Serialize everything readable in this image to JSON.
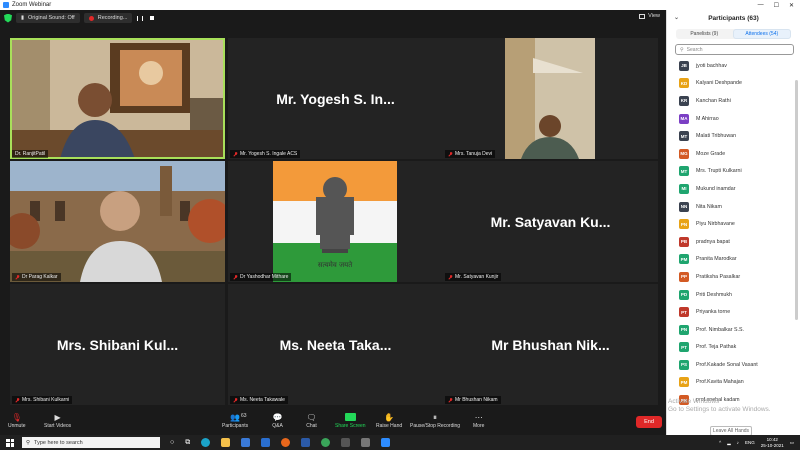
{
  "window": {
    "title": "Zoom Webinar"
  },
  "topbar": {
    "audio_label": "Original Sound: Off",
    "recording_label": "Recording...",
    "view_label": "View"
  },
  "tiles": [
    {
      "caption": "Dr. RanjitPatil",
      "bigname": "",
      "muted": false
    },
    {
      "caption": "Mr. Yogesh S. Ingale ACS",
      "bigname": "Mr. Yogesh S. In...",
      "muted": true
    },
    {
      "caption": "Mrs. Tanuja Devi",
      "bigname": "",
      "muted": true
    },
    {
      "caption": "Dr Parag Kalkar",
      "bigname": "",
      "muted": true
    },
    {
      "caption": "Dr Yashodhar Mithare",
      "bigname": "",
      "muted": true
    },
    {
      "caption": "Mr. Satyavan Kunjir",
      "bigname": "Mr. Satyavan Ku...",
      "muted": true
    },
    {
      "caption": "Mrs. Shibani Kulkarni",
      "bigname": "Mrs. Shibani Kul...",
      "muted": true
    },
    {
      "caption": "Ms. Neeta Takawale",
      "bigname": "Ms. Neeta Taka...",
      "muted": true
    },
    {
      "caption": "Mr Bhushan Nikam",
      "bigname": "Mr Bhushan Nik...",
      "muted": true
    }
  ],
  "emblem_motto": "सत्यमेव जयते",
  "sidebar": {
    "title": "Participants (63)",
    "tabs": [
      "Panelists (9)",
      "Attendees (54)"
    ],
    "search_placeholder": "Search",
    "participants": [
      {
        "initials": "JB",
        "name": "jyoti bachhav",
        "color": "#3a4250"
      },
      {
        "initials": "KD",
        "name": "Kalyani Deshpande",
        "color": "#e8a317"
      },
      {
        "initials": "KR",
        "name": "Kanchan  Rathi",
        "color": "#3a4250"
      },
      {
        "initials": "MA",
        "name": "M Ahirrao",
        "color": "#7b3fc4"
      },
      {
        "initials": "MT",
        "name": "Malati Tribhuwan",
        "color": "#3a4250"
      },
      {
        "initials": "MG",
        "name": "Moze Grade",
        "color": "#d35a24"
      },
      {
        "initials": "MT",
        "name": "Mrs. Trupti Kulkarni",
        "color": "#1fa56f"
      },
      {
        "initials": "MI",
        "name": "Mukund inamdar",
        "color": "#1fa56f"
      },
      {
        "initials": "NN",
        "name": "Nita Nikam",
        "color": "#3a4250"
      },
      {
        "initials": "PN",
        "name": "Piyu Nirbhavane",
        "color": "#e8a317"
      },
      {
        "initials": "PB",
        "name": "pradnya bapat",
        "color": "#c0392b"
      },
      {
        "initials": "PM",
        "name": "Pranita Marodkar",
        "color": "#1fa56f"
      },
      {
        "initials": "PP",
        "name": "Pratiksha Pasalkar",
        "color": "#d35a24"
      },
      {
        "initials": "PD",
        "name": "Priti Deshmukh",
        "color": "#1fa56f"
      },
      {
        "initials": "PT",
        "name": "Priyanka torne",
        "color": "#c0392b"
      },
      {
        "initials": "PN",
        "name": "Prof. Nimbalkar S.S.",
        "color": "#1fa56f"
      },
      {
        "initials": "PT",
        "name": "Prof. Teja Pathak",
        "color": "#1fa56f"
      },
      {
        "initials": "PS",
        "name": "Prof.Kakade Sonal Vasant",
        "color": "#1fa56f"
      },
      {
        "initials": "PM",
        "name": "Prof.Kavita Mahajan",
        "color": "#e8a317"
      },
      {
        "initials": "PK",
        "name": "prof.snehal kadam",
        "color": "#d35a24"
      }
    ],
    "leave_all_label": "Leave All Hands"
  },
  "activation": {
    "line1": "Activate Windows",
    "line2": "Go to Settings to activate Windows."
  },
  "controls": {
    "unmute": "Unmute",
    "start_video": "Start Videos",
    "participants": "Participants",
    "participants_count": "63",
    "qa": "Q&A",
    "chat": "Chat",
    "share": "Share Screen",
    "raise_hand": "Raise Hand",
    "pause_rec": "Pause/Stop Recording",
    "more": "More",
    "end": "End"
  },
  "taskbar": {
    "search_placeholder": "Type here to search",
    "lang": "ENG",
    "time": "10:42",
    "date": "25-10-2021"
  }
}
